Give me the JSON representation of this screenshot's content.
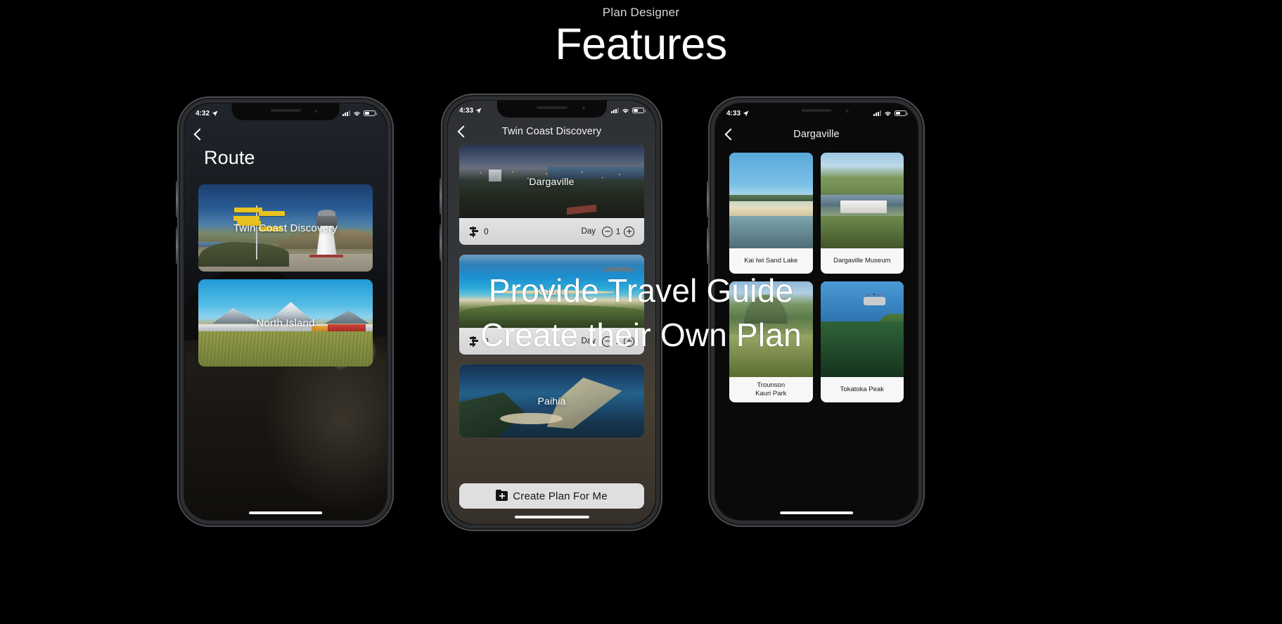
{
  "header": {
    "eyebrow": "Plan Designer",
    "title": "Features"
  },
  "tagline": {
    "line1": "Provide Travel Guide",
    "line2": "Create their Own Plan"
  },
  "phones": [
    {
      "id": "route-screen",
      "statusbar": {
        "time": "4:32",
        "location_icon": "location-arrow-icon",
        "signal_icon": "cellular-signal-icon",
        "wifi_icon": "wifi-icon",
        "battery_icon": "battery-icon"
      },
      "nav": {
        "back_icon": "back-chevron-icon",
        "title": ""
      },
      "large_title": "Route",
      "cards": [
        {
          "label": "Twin Coast Discovery"
        },
        {
          "label": "North Island"
        }
      ]
    },
    {
      "id": "twin-coast-discovery-screen",
      "statusbar": {
        "time": "4:33",
        "location_icon": "location-arrow-icon",
        "signal_icon": "cellular-signal-icon",
        "wifi_icon": "wifi-icon",
        "battery_icon": "battery-icon"
      },
      "nav": {
        "back_icon": "back-chevron-icon",
        "title": "Twin Coast Discovery"
      },
      "stops": [
        {
          "name": "Dargaville",
          "spot_icon": "signpost-icon",
          "spot_count": "0",
          "day_label": "Day",
          "day_value": "1",
          "minus_icon": "minus-circle-icon",
          "plus_icon": "plus-circle-icon"
        },
        {
          "name": "Kaitaia",
          "spot_icon": "signpost-icon",
          "spot_count": "0",
          "day_label": "Day",
          "day_value": "1",
          "minus_icon": "minus-circle-icon",
          "plus_icon": "plus-circle-icon"
        },
        {
          "name": "Paihia"
        }
      ],
      "create_button": {
        "icon": "folder-plus-icon",
        "label": "Create Plan For Me"
      }
    },
    {
      "id": "dargaville-screen",
      "statusbar": {
        "time": "4:33",
        "location_icon": "location-arrow-icon",
        "signal_icon": "cellular-signal-icon",
        "wifi_icon": "wifi-icon",
        "battery_icon": "battery-icon"
      },
      "nav": {
        "back_icon": "back-chevron-icon",
        "title": "Dargaville"
      },
      "places": [
        {
          "label": "Kai Iwi Sand Lake"
        },
        {
          "label": "Dargaville Museum"
        },
        {
          "label": "Trounson\nKauri Park"
        },
        {
          "label": "Tokatoka Peak"
        }
      ]
    }
  ],
  "colors": {
    "background": "#000000",
    "eyebrow": "#d8d8d8",
    "title": "#fdfdfd",
    "card_surface": "#f7f7f7",
    "row_surface": "#dcdcdc",
    "button_surface": "#dfdfdf"
  }
}
